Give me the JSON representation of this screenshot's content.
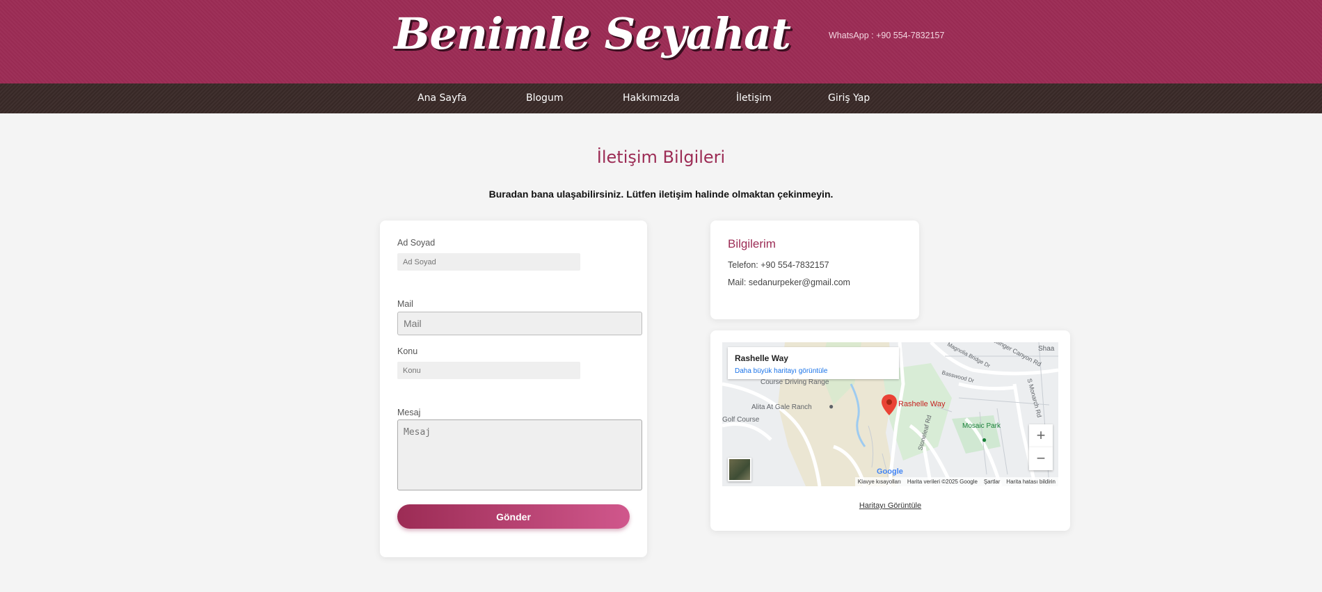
{
  "header": {
    "logo_text": "Benimle Seyahat",
    "whatsapp": "WhatsApp : +90 554-7832157"
  },
  "nav": {
    "items": [
      {
        "label": "Ana Sayfa"
      },
      {
        "label": "Blogum"
      },
      {
        "label": "Hakkımızda"
      },
      {
        "label": "İletişim"
      },
      {
        "label": "Giriş Yap"
      }
    ]
  },
  "main": {
    "title": "İletişim Bilgileri",
    "lead": "Buradan bana ulaşabilirsiniz. Lütfen iletişim halinde olmaktan çekinmeyin."
  },
  "form": {
    "name_label": "Ad Soyad",
    "name_placeholder": "Ad Soyad",
    "mail_label": "Mail",
    "mail_placeholder": "Mail",
    "subject_label": "Konu",
    "subject_placeholder": "Konu",
    "message_label": "Mesaj",
    "message_placeholder": "Mesaj",
    "submit_label": "Gönder"
  },
  "info": {
    "title": "Bilgilerim",
    "phone": "Telefon: +90 554-7832157",
    "mail": "Mail: sedanurpeker@gmail.com"
  },
  "map": {
    "place_name": "Rashelle Way",
    "larger_map_link": "Daha büyük haritayı görüntüle",
    "view_map_link": "Haritayı Görüntüle",
    "labels": {
      "course_driving_range": "Course Driving Range",
      "alita": "Alita At Gale Ranch",
      "golf_course": "Golf Course",
      "marker_label": "Rashelle Way",
      "mosaic_park": "Mosaic Park",
      "bollinger": "Bollinger Canyon Rd",
      "magnolia": "Magnolia Bridge Dr",
      "basswood": "Basswood Dr",
      "monarch": "S Monarch Rd",
      "stoneleaf": "Stoneleaf Rd",
      "shaa": "Shaa",
      "google": "Google"
    },
    "attribution": {
      "shortcuts": "Klavye kısayolları",
      "data": "Harita verileri ©2025 Google",
      "terms": "Şartlar",
      "report": "Harita hatası bildirin"
    },
    "zoom_in": "+",
    "zoom_out": "−",
    "colors": {
      "park_green": "#c8e6c9",
      "road": "#ffffff",
      "marker": "#ea4335",
      "water": "#9ecbf0"
    }
  },
  "theme": {
    "primary": "#9c2c55",
    "nav_bg": "#3a2a28",
    "page_bg": "#f4f4f4"
  }
}
